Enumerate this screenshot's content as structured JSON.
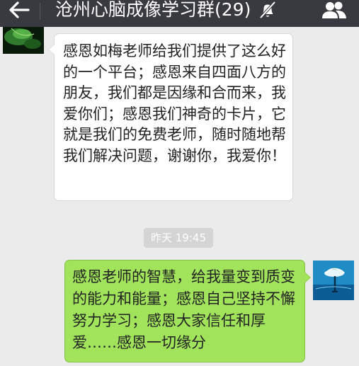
{
  "header": {
    "title": "沧州心脑成像学习群(29)",
    "back_icon": "arrow-left-icon",
    "mute_icon": "bell-muted-icon",
    "contacts_icon": "group-contacts-icon",
    "background_color": "#393a3f"
  },
  "messages": [
    {
      "side": "left",
      "text": "感恩如梅老师给我们提供了这么好的一个平台；感恩来自四面八方的朋友，我们都是因缘和合而来，我爱你们；感恩我们神奇的卡片，它就是我们的免费老师，随时随地帮我们解决问题，谢谢你，我爱你！",
      "bubble_color": "#ffffff"
    },
    {
      "side": "right",
      "text": "感恩老师的智慧，给我量变到质变的能力和能量；感恩自己坚持不懈努力学习；感恩大家信任和厚爱……感恩一切缘分",
      "bubble_color": "#a1e45c"
    }
  ],
  "timestamp": {
    "text": "昨天 19:45"
  }
}
